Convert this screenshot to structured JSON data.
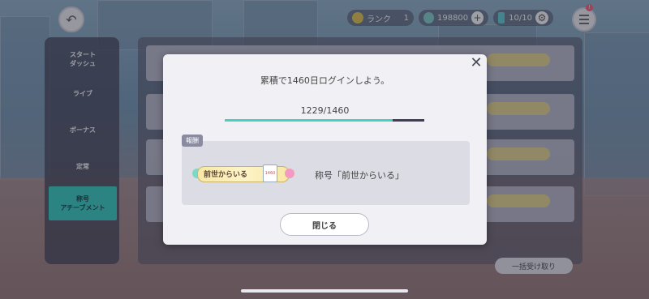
{
  "header": {
    "rank_label": "ランク",
    "rank_value": "1",
    "crystal_value": "198800",
    "stamina_value": "10/10",
    "menu_badge": "!"
  },
  "sidebar": {
    "items": [
      {
        "label": "スタート\nダッシュ"
      },
      {
        "label": "ライブ"
      },
      {
        "label": "ボーナス"
      },
      {
        "label": "定常"
      },
      {
        "label": "称号\nアチーブメント"
      }
    ]
  },
  "list": {
    "bulk_receive_label": "一括受け取り"
  },
  "modal": {
    "title": "累積で1460日ログインしよう。",
    "progress_text": "1229/1460",
    "progress_fraction": 0.8418,
    "reward_tag": "報酬",
    "plate_text": "前世からいる",
    "plate_card_text": "1460",
    "reward_name": "称号「前世からいる」",
    "close_label": "閉じる"
  },
  "colors": {
    "accent": "#41d2c4",
    "dark_bar": "#3e3e56"
  }
}
